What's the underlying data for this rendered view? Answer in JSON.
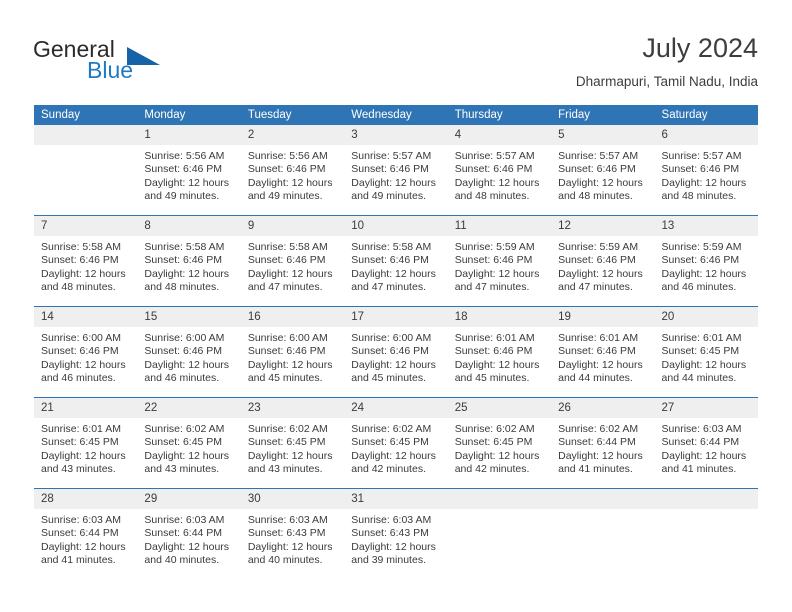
{
  "brand": {
    "name_part1": "General",
    "name_part2": "Blue",
    "logo_icon": "triangle-flag-icon",
    "accent_color": "#1f7ac4"
  },
  "header": {
    "title": "July 2024",
    "location": "Dharmapuri, Tamil Nadu, India"
  },
  "theme": {
    "header_blue": "#2f75b5",
    "daynum_gray": "#efefef",
    "text": "#3b3b3b"
  },
  "calendar": {
    "weekday_headers": [
      "Sunday",
      "Monday",
      "Tuesday",
      "Wednesday",
      "Thursday",
      "Friday",
      "Saturday"
    ],
    "weeks": [
      [
        {
          "day": "",
          "empty": true,
          "sunrise": "",
          "sunset": "",
          "daylight1": "",
          "daylight2": ""
        },
        {
          "day": "1",
          "sunrise": "Sunrise: 5:56 AM",
          "sunset": "Sunset: 6:46 PM",
          "daylight1": "Daylight: 12 hours",
          "daylight2": "and 49 minutes."
        },
        {
          "day": "2",
          "sunrise": "Sunrise: 5:56 AM",
          "sunset": "Sunset: 6:46 PM",
          "daylight1": "Daylight: 12 hours",
          "daylight2": "and 49 minutes."
        },
        {
          "day": "3",
          "sunrise": "Sunrise: 5:57 AM",
          "sunset": "Sunset: 6:46 PM",
          "daylight1": "Daylight: 12 hours",
          "daylight2": "and 49 minutes."
        },
        {
          "day": "4",
          "sunrise": "Sunrise: 5:57 AM",
          "sunset": "Sunset: 6:46 PM",
          "daylight1": "Daylight: 12 hours",
          "daylight2": "and 48 minutes."
        },
        {
          "day": "5",
          "sunrise": "Sunrise: 5:57 AM",
          "sunset": "Sunset: 6:46 PM",
          "daylight1": "Daylight: 12 hours",
          "daylight2": "and 48 minutes."
        },
        {
          "day": "6",
          "sunrise": "Sunrise: 5:57 AM",
          "sunset": "Sunset: 6:46 PM",
          "daylight1": "Daylight: 12 hours",
          "daylight2": "and 48 minutes."
        }
      ],
      [
        {
          "day": "7",
          "sunrise": "Sunrise: 5:58 AM",
          "sunset": "Sunset: 6:46 PM",
          "daylight1": "Daylight: 12 hours",
          "daylight2": "and 48 minutes."
        },
        {
          "day": "8",
          "sunrise": "Sunrise: 5:58 AM",
          "sunset": "Sunset: 6:46 PM",
          "daylight1": "Daylight: 12 hours",
          "daylight2": "and 48 minutes."
        },
        {
          "day": "9",
          "sunrise": "Sunrise: 5:58 AM",
          "sunset": "Sunset: 6:46 PM",
          "daylight1": "Daylight: 12 hours",
          "daylight2": "and 47 minutes."
        },
        {
          "day": "10",
          "sunrise": "Sunrise: 5:58 AM",
          "sunset": "Sunset: 6:46 PM",
          "daylight1": "Daylight: 12 hours",
          "daylight2": "and 47 minutes."
        },
        {
          "day": "11",
          "sunrise": "Sunrise: 5:59 AM",
          "sunset": "Sunset: 6:46 PM",
          "daylight1": "Daylight: 12 hours",
          "daylight2": "and 47 minutes."
        },
        {
          "day": "12",
          "sunrise": "Sunrise: 5:59 AM",
          "sunset": "Sunset: 6:46 PM",
          "daylight1": "Daylight: 12 hours",
          "daylight2": "and 47 minutes."
        },
        {
          "day": "13",
          "sunrise": "Sunrise: 5:59 AM",
          "sunset": "Sunset: 6:46 PM",
          "daylight1": "Daylight: 12 hours",
          "daylight2": "and 46 minutes."
        }
      ],
      [
        {
          "day": "14",
          "sunrise": "Sunrise: 6:00 AM",
          "sunset": "Sunset: 6:46 PM",
          "daylight1": "Daylight: 12 hours",
          "daylight2": "and 46 minutes."
        },
        {
          "day": "15",
          "sunrise": "Sunrise: 6:00 AM",
          "sunset": "Sunset: 6:46 PM",
          "daylight1": "Daylight: 12 hours",
          "daylight2": "and 46 minutes."
        },
        {
          "day": "16",
          "sunrise": "Sunrise: 6:00 AM",
          "sunset": "Sunset: 6:46 PM",
          "daylight1": "Daylight: 12 hours",
          "daylight2": "and 45 minutes."
        },
        {
          "day": "17",
          "sunrise": "Sunrise: 6:00 AM",
          "sunset": "Sunset: 6:46 PM",
          "daylight1": "Daylight: 12 hours",
          "daylight2": "and 45 minutes."
        },
        {
          "day": "18",
          "sunrise": "Sunrise: 6:01 AM",
          "sunset": "Sunset: 6:46 PM",
          "daylight1": "Daylight: 12 hours",
          "daylight2": "and 45 minutes."
        },
        {
          "day": "19",
          "sunrise": "Sunrise: 6:01 AM",
          "sunset": "Sunset: 6:46 PM",
          "daylight1": "Daylight: 12 hours",
          "daylight2": "and 44 minutes."
        },
        {
          "day": "20",
          "sunrise": "Sunrise: 6:01 AM",
          "sunset": "Sunset: 6:45 PM",
          "daylight1": "Daylight: 12 hours",
          "daylight2": "and 44 minutes."
        }
      ],
      [
        {
          "day": "21",
          "sunrise": "Sunrise: 6:01 AM",
          "sunset": "Sunset: 6:45 PM",
          "daylight1": "Daylight: 12 hours",
          "daylight2": "and 43 minutes."
        },
        {
          "day": "22",
          "sunrise": "Sunrise: 6:02 AM",
          "sunset": "Sunset: 6:45 PM",
          "daylight1": "Daylight: 12 hours",
          "daylight2": "and 43 minutes."
        },
        {
          "day": "23",
          "sunrise": "Sunrise: 6:02 AM",
          "sunset": "Sunset: 6:45 PM",
          "daylight1": "Daylight: 12 hours",
          "daylight2": "and 43 minutes."
        },
        {
          "day": "24",
          "sunrise": "Sunrise: 6:02 AM",
          "sunset": "Sunset: 6:45 PM",
          "daylight1": "Daylight: 12 hours",
          "daylight2": "and 42 minutes."
        },
        {
          "day": "25",
          "sunrise": "Sunrise: 6:02 AM",
          "sunset": "Sunset: 6:45 PM",
          "daylight1": "Daylight: 12 hours",
          "daylight2": "and 42 minutes."
        },
        {
          "day": "26",
          "sunrise": "Sunrise: 6:02 AM",
          "sunset": "Sunset: 6:44 PM",
          "daylight1": "Daylight: 12 hours",
          "daylight2": "and 41 minutes."
        },
        {
          "day": "27",
          "sunrise": "Sunrise: 6:03 AM",
          "sunset": "Sunset: 6:44 PM",
          "daylight1": "Daylight: 12 hours",
          "daylight2": "and 41 minutes."
        }
      ],
      [
        {
          "day": "28",
          "sunrise": "Sunrise: 6:03 AM",
          "sunset": "Sunset: 6:44 PM",
          "daylight1": "Daylight: 12 hours",
          "daylight2": "and 41 minutes."
        },
        {
          "day": "29",
          "sunrise": "Sunrise: 6:03 AM",
          "sunset": "Sunset: 6:44 PM",
          "daylight1": "Daylight: 12 hours",
          "daylight2": "and 40 minutes."
        },
        {
          "day": "30",
          "sunrise": "Sunrise: 6:03 AM",
          "sunset": "Sunset: 6:43 PM",
          "daylight1": "Daylight: 12 hours",
          "daylight2": "and 40 minutes."
        },
        {
          "day": "31",
          "sunrise": "Sunrise: 6:03 AM",
          "sunset": "Sunset: 6:43 PM",
          "daylight1": "Daylight: 12 hours",
          "daylight2": "and 39 minutes."
        },
        {
          "day": "",
          "empty": true,
          "sunrise": "",
          "sunset": "",
          "daylight1": "",
          "daylight2": ""
        },
        {
          "day": "",
          "empty": true,
          "sunrise": "",
          "sunset": "",
          "daylight1": "",
          "daylight2": ""
        },
        {
          "day": "",
          "empty": true,
          "sunrise": "",
          "sunset": "",
          "daylight1": "",
          "daylight2": ""
        }
      ]
    ]
  }
}
